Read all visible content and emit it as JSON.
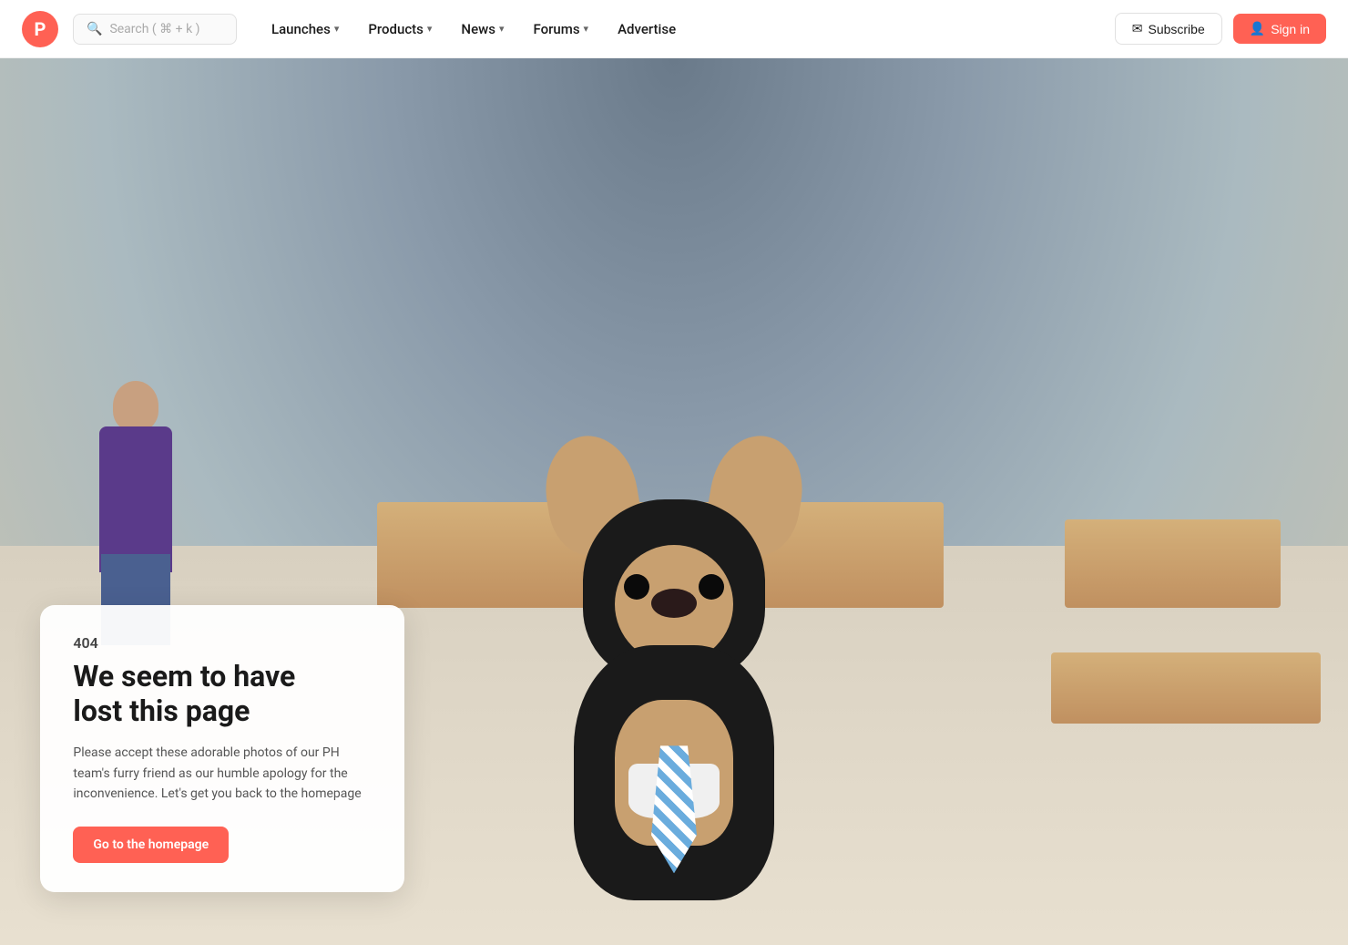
{
  "brand": {
    "logo_letter": "P",
    "logo_color": "#ff6154"
  },
  "navbar": {
    "search_placeholder": "Search ( ⌘ + k )",
    "nav_items": [
      {
        "label": "Launches",
        "has_dropdown": true
      },
      {
        "label": "Products",
        "has_dropdown": true
      },
      {
        "label": "News",
        "has_dropdown": true
      },
      {
        "label": "Forums",
        "has_dropdown": true
      },
      {
        "label": "Advertise",
        "has_dropdown": false
      }
    ],
    "subscribe_label": "Subscribe",
    "signin_label": "Sign in"
  },
  "error_page": {
    "code": "404",
    "title_line1": "We seem to have",
    "title_line2": "lost this page",
    "description": "Please accept these adorable photos of our PH team's furry friend as our humble apology for the inconvenience. Let's get you back to the homepage",
    "cta_label": "Go to the homepage"
  }
}
